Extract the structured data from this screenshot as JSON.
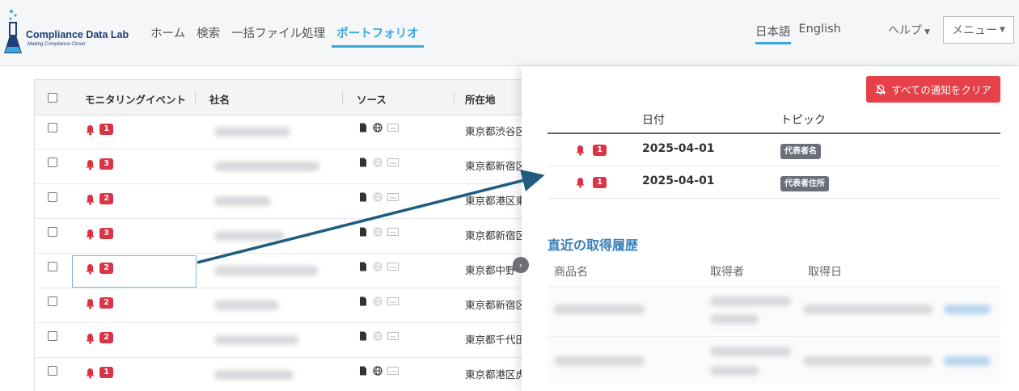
{
  "header": {
    "logo_title": "Compliance Data Lab",
    "logo_subtitle": "Making Compliance Closer",
    "nav": [
      "ホーム",
      "検索",
      "一括ファイル処理",
      "ポートフォリオ"
    ],
    "nav_active_index": 3,
    "languages": [
      "日本語",
      "English"
    ],
    "language_active_index": 0,
    "help_label": "ヘルプ",
    "menu_label": "メニュー"
  },
  "table": {
    "columns": [
      "モニタリングイベント",
      "社名",
      "ソース",
      "所在地"
    ],
    "rows": [
      {
        "count": "1",
        "location": "東京都渋谷区"
      },
      {
        "count": "3",
        "location": "東京都新宿区"
      },
      {
        "count": "2",
        "location": "東京都港区東"
      },
      {
        "count": "3",
        "location": "東京都新宿区"
      },
      {
        "count": "2",
        "location": "東京都中野"
      },
      {
        "count": "2",
        "location": "東京都新宿区"
      },
      {
        "count": "2",
        "location": "東京都千代田"
      },
      {
        "count": "1",
        "location": "東京都港区虎"
      }
    ],
    "selected_row_index": 4
  },
  "panel": {
    "clear_label": "すべての通知をクリア",
    "notification_headers": [
      "日付",
      "トピック"
    ],
    "notifications": [
      {
        "count": "1",
        "date": "2025-04-01",
        "topic": "代表者名"
      },
      {
        "count": "1",
        "date": "2025-04-01",
        "topic": "代表者住所"
      }
    ],
    "history_title": "直近の取得履歴",
    "history_headers": [
      "商品名",
      "取得者",
      "取得日"
    ]
  },
  "colors": {
    "accent": "#3ba8dd",
    "badge": "#d93546",
    "clear_button": "#e64048",
    "tag": "#6b7078",
    "section_title": "#3a7fb8",
    "arrow": "#1f5c80"
  }
}
